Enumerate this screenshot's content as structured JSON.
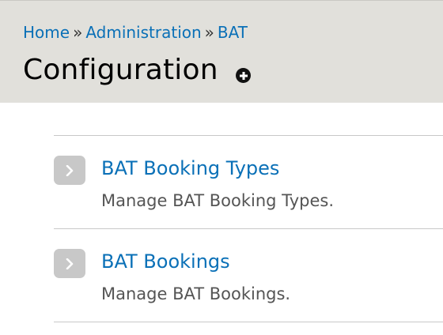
{
  "breadcrumb": {
    "items": [
      "Home",
      "Administration",
      "BAT"
    ],
    "separator": "»"
  },
  "page": {
    "title": "Configuration"
  },
  "admin_list": [
    {
      "title": "BAT Booking Types",
      "description": "Manage BAT Booking Types."
    },
    {
      "title": "BAT Bookings",
      "description": "Manage BAT Bookings."
    }
  ],
  "colors": {
    "header_bg": "#e1e0db",
    "link": "#0a70b7",
    "arrow_button_bg": "#c8c8c8",
    "description_text": "#555555"
  },
  "icons": {
    "shortcut": "add-shortcut-icon",
    "entry_arrow": "chevron-right-icon"
  }
}
